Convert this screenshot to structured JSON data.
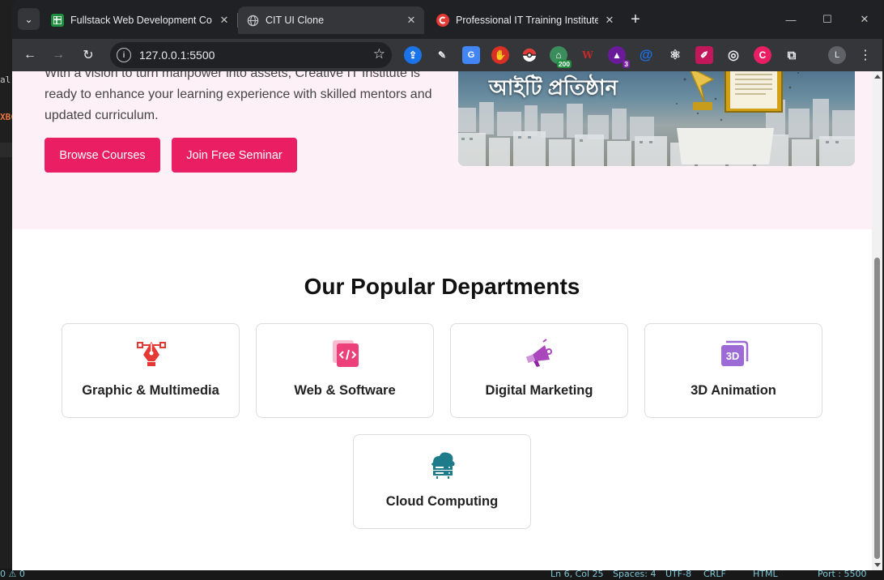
{
  "browser": {
    "tabs": [
      {
        "title": "Fullstack Web Development Co",
        "favicon": "sheets-icon",
        "active": false
      },
      {
        "title": "CIT UI Clone",
        "favicon": "globe-icon",
        "active": true
      },
      {
        "title": "Professional IT Training Institute",
        "favicon": "creative-it-icon",
        "active": false
      }
    ],
    "url": "127.0.0.1:5500",
    "profile_initial": "L",
    "extension_badges": {
      "green": "200",
      "purple": "3"
    }
  },
  "background_editor": {
    "fragments": [
      "al",
      "XBC"
    ],
    "statusbar": {
      "problems": "0 ⚠ 0",
      "position": "Ln 6, Col 25",
      "spaces": "Spaces: 4",
      "encoding": "UTF-8",
      "eol": "CRLF",
      "language": "HTML",
      "port": "Port : 5500"
    }
  },
  "hero": {
    "description": "With a vision to turn manpower into assets, Creative IT Institute is ready to enhance your learning experience with skilled mentors and updated curriculum.",
    "browse_label": "Browse Courses",
    "seminar_label": "Join Free Seminar",
    "image_caption": "আইটি প্রতিষ্ঠান"
  },
  "departments": {
    "title": "Our Popular Departments",
    "items": [
      {
        "label": "Graphic & Multimedia",
        "icon": "pen-tool-icon",
        "color": "#e53935"
      },
      {
        "label": "Web & Software",
        "icon": "code-file-icon",
        "color": "#ec407a"
      },
      {
        "label": "Digital Marketing",
        "icon": "megaphone-icon",
        "color": "#ab47bc"
      },
      {
        "label": "3D Animation",
        "icon": "3d-cube-icon",
        "color": "#9c6bd6",
        "icon_text": "3D"
      },
      {
        "label": "Cloud Computing",
        "icon": "cloud-server-icon",
        "color": "#1e7b8a"
      }
    ]
  },
  "colors": {
    "accent": "#e91e63",
    "hero_bg": "#fdf0f6"
  }
}
